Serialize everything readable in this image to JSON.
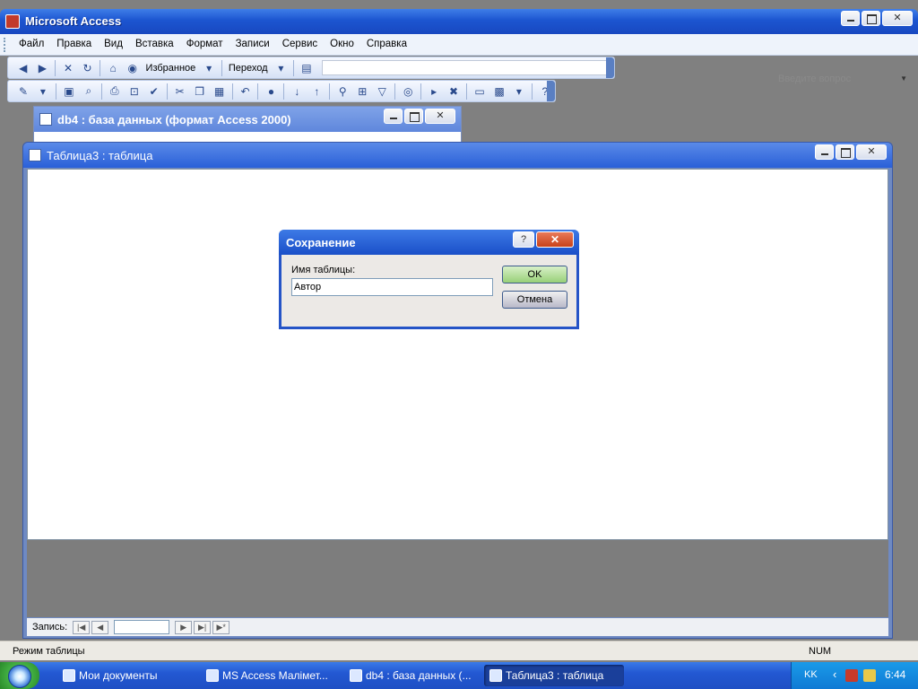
{
  "app": {
    "title": "Microsoft Access"
  },
  "menu": {
    "items": [
      "Файл",
      "Правка",
      "Вид",
      "Вставка",
      "Формат",
      "Записи",
      "Сервис",
      "Окно",
      "Справка"
    ]
  },
  "help": {
    "placeholder": "Введите вопрос"
  },
  "web_toolbar": {
    "favorites_label": "Избранное",
    "goto_label": "Переход"
  },
  "db_window": {
    "title": "db4 : база данных (формат Access 2000)"
  },
  "table_window": {
    "title": "Таблица3 : таблица",
    "nav_label": "Запись:"
  },
  "dialog": {
    "title": "Сохранение",
    "help_glyph": "?",
    "field_label": "Имя таблицы:",
    "field_value": "Автор",
    "ok_label": "OK",
    "cancel_label": "Отмена"
  },
  "statusbar": {
    "mode": "Режим таблицы",
    "num": "NUM"
  },
  "taskbar": {
    "tasks": [
      {
        "label": "Мои документы",
        "active": false
      },
      {
        "label": "MS Access Малімет...",
        "active": false
      },
      {
        "label": "db4 : база данных (...",
        "active": false
      },
      {
        "label": "Таблица3 : таблица",
        "active": true
      }
    ],
    "lang": "KK",
    "clock": "6:44"
  },
  "colors": {
    "titlebar": "#1c55d0",
    "dialog_border": "#2554c7",
    "ok_button": "#98d078",
    "work_area": "#808080"
  }
}
